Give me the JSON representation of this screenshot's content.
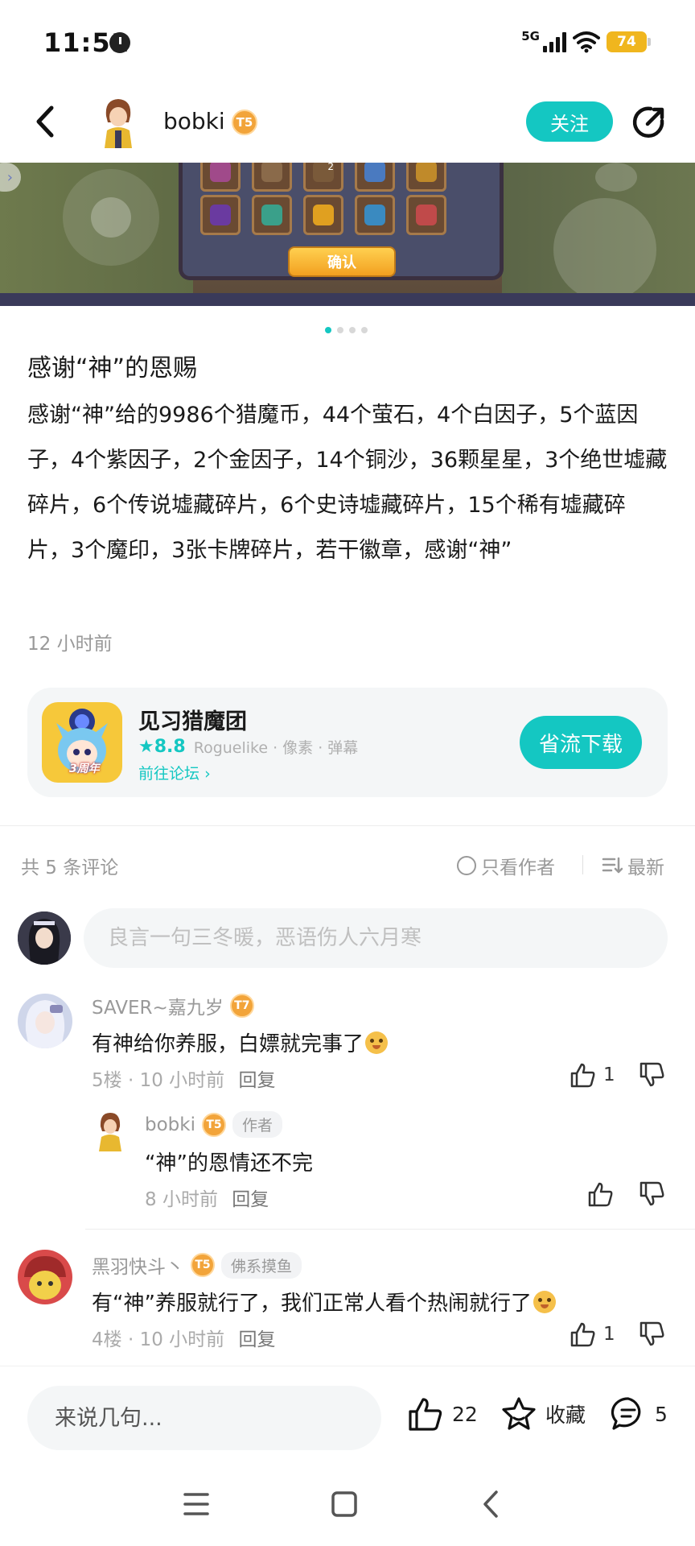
{
  "status_bar": {
    "time": "11:51",
    "network": "5G",
    "battery": "74"
  },
  "header": {
    "username": "bobki",
    "level": "5",
    "follow_label": "关注"
  },
  "banner": {
    "confirm_label": "确认",
    "slot_badge": "2",
    "page_count": 4,
    "active_page": 0
  },
  "post": {
    "title": "感谢“神”的恩赐",
    "body": "感谢“神”给的9986个猎魔币，44个萤石，4个白因子，5个蓝因子，4个紫因子，2个金因子，14个铜沙，36颗星星，3个绝世墟藏碎片，6个传说墟藏碎片，6个史诗墟藏碎片，15个稀有墟藏碎片，3个魔印，3张卡牌碎片，若干徽章，感谢“神”",
    "time": "12 小时前"
  },
  "game_card": {
    "name": "见习猎魔团",
    "rating": "8.8",
    "tags": "Roguelike · 像素 · 弹幕",
    "forum_link": "前往论坛",
    "download_label": "省流下载",
    "icon_badge": "3周年"
  },
  "comments_header": {
    "count_text": "共 5 条评论",
    "author_only": "只看作者",
    "sort": "最新"
  },
  "comment_input": {
    "placeholder": "良言一句三冬暖，恶语伤人六月寒"
  },
  "comments": [
    {
      "user": "SAVER~嘉九岁",
      "level": "7",
      "text": "有神给你养服，白嫖就完事了",
      "floor": "5楼",
      "time": "10 小时前",
      "reply_label": "回复",
      "likes": "1"
    },
    {
      "user": "bobki",
      "level": "5",
      "tag": "作者",
      "text": "“神”的恩情还不完",
      "time": "8 小时前",
      "reply_label": "回复"
    },
    {
      "user": "黑羽快斗丶",
      "level": "5",
      "tag": "佛系摸鱼",
      "text": "有“神”养服就行了，我们正常人看个热闹就行了",
      "floor": "4楼",
      "time": "10 小时前",
      "reply_label": "回复",
      "likes": "1"
    }
  ],
  "bottom_bar": {
    "placeholder": "来说几句...",
    "likes": "22",
    "favorite_label": "收藏",
    "comments": "5"
  },
  "colors": {
    "accent": "#14c7c2",
    "level_badge": "#f2a43a",
    "muted_text": "#999999"
  }
}
